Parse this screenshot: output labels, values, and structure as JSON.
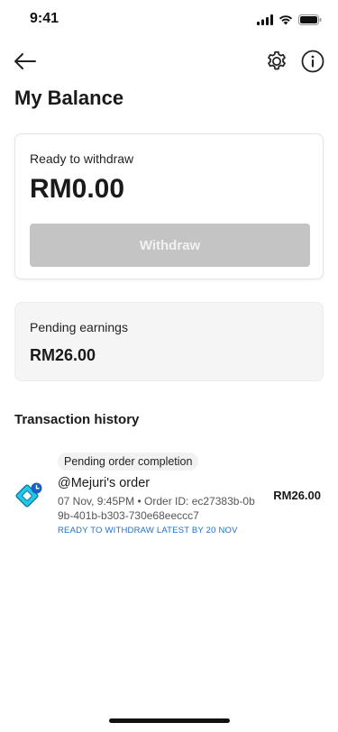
{
  "status_bar": {
    "time": "9:41"
  },
  "header": {
    "back_icon": "arrow-left-icon",
    "settings_icon": "gear-icon",
    "info_icon": "info-icon",
    "title": "My Balance"
  },
  "withdraw_card": {
    "label": "Ready to withdraw",
    "amount": "RM0.00",
    "button_label": "Withdraw",
    "button_color": "#c4c4c4"
  },
  "pending_card": {
    "label": "Pending earnings",
    "amount": "RM26.00"
  },
  "transactions": {
    "title": "Transaction history",
    "items": [
      {
        "badge": "Pending order completion",
        "title": "@Mejuri's order",
        "meta": "07 Nov, 9:45PM  • Order ID: ec27383b-0b9b-401b-b303-730e68eeccc7",
        "note": "READY TO WITHDRAW LATEST BY 20 NOV",
        "amount": "RM26.00",
        "icon": "pending-payment-icon"
      }
    ]
  },
  "colors": {
    "accent_blue": "#1a6fd3",
    "icon_cyan": "#1ec8e6"
  }
}
